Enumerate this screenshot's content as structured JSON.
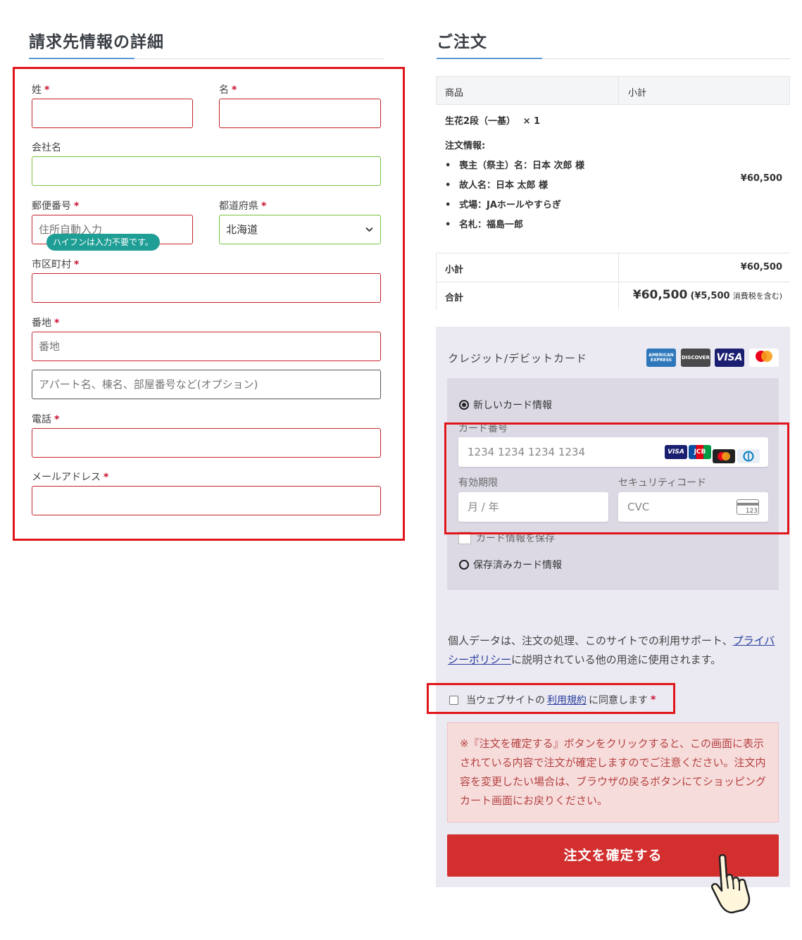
{
  "billing": {
    "title": "請求先情報の詳細",
    "required_mark": "*",
    "last_name_label": "姓",
    "first_name_label": "名",
    "company_label": "会社名",
    "postcode_label": "郵便番号",
    "postcode_placeholder": "住所自動入力",
    "postcode_tooltip": "ハイフンは入力不要です。",
    "prefecture_label": "都道府県",
    "prefecture_value": "北海道",
    "city_label": "市区町村",
    "address_label": "番地",
    "address_placeholder": "番地",
    "address2_placeholder": "アパート名、棟名、部屋番号など(オプション)",
    "phone_label": "電話",
    "email_label": "メールアドレス"
  },
  "order": {
    "title": "ご注文",
    "col_product": "商品",
    "col_subtotal": "小計",
    "product_name": "生花2段（一基）",
    "quantity": "× 1",
    "info_title": "注文情報:",
    "info_items": [
      "喪主（祭主）名：日本 次郎 様",
      "故人名：日本 太郎 様",
      "式場：JAホールやすらぎ",
      "名札：福島一郎"
    ],
    "line_total": "¥60,500",
    "subtotal_label": "小計",
    "subtotal_value": "¥60,500",
    "total_label": "合計",
    "total_value": "¥60,500",
    "tax_note_open": "(",
    "tax_amount": "¥5,500",
    "tax_note": "消費税を含む)"
  },
  "payment": {
    "method_label": "クレジット/デビットカード",
    "brands": [
      "AMERICAN EXPRESS",
      "DISCOVER",
      "VISA",
      "mastercard"
    ],
    "new_card_label": "新しいカード情報",
    "card_number_label": "カード番号",
    "card_number_placeholder": "1234 1234 1234 1234",
    "field_brands": [
      "VISA",
      "JCB",
      "mastercard",
      "Diners"
    ],
    "expiry_label": "有効期限",
    "expiry_placeholder": "月 / 年",
    "cvc_label": "セキュリティコード",
    "cvc_placeholder": "CVC",
    "cvc_icon_text": "123",
    "save_card_label": "カード情報を保存",
    "saved_card_label": "保存済みカード情報"
  },
  "privacy": {
    "text_before": "個人データは、注文の処理、このサイトでの利用サポート、",
    "link_text": "プライバシーポリシー",
    "text_after": "に説明されている他の用途に使用されます。"
  },
  "terms": {
    "text_before": "当ウェブサイトの ",
    "link_text": "利用規約",
    "text_after": " に同意します",
    "required_mark": "*"
  },
  "notice": {
    "text": "※『注文を確定する』ボタンをクリックすると、この画面に表示されている内容で注文が確定しますのでご注意ください。注文内容を変更したい場合は、ブラウザの戻るボタンにてショッピングカート画面にお戻りください。"
  },
  "place_order_label": "注文を確定する",
  "colors": {
    "accent_blue": "#5b9bd5",
    "highlight_red": "#e0161a",
    "error_border": "#c4242b",
    "valid_border": "#7ac142",
    "tooltip_teal": "#1f9e95",
    "button_red": "#d32f2f",
    "notice_text": "#b4423f"
  }
}
